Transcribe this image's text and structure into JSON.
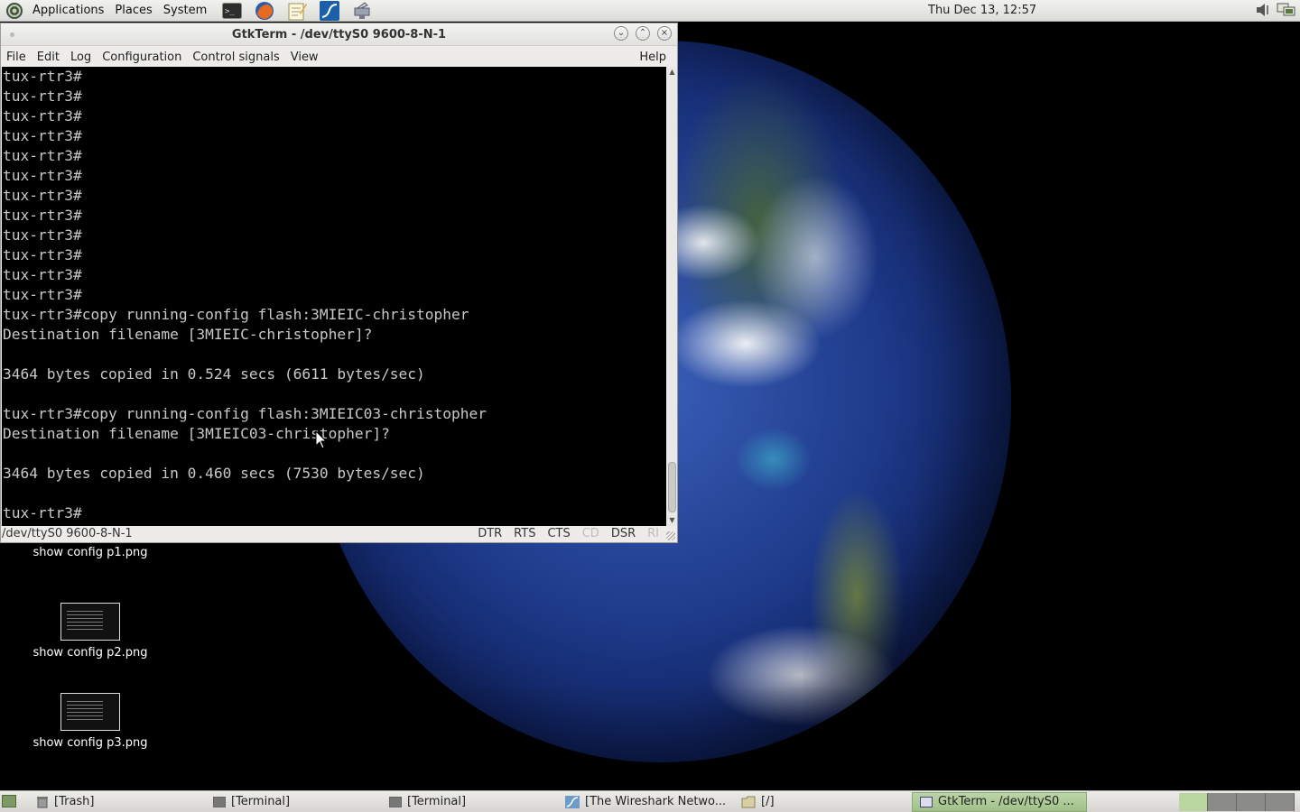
{
  "top_panel": {
    "menus": [
      "Applications",
      "Places",
      "System"
    ],
    "launchers": [
      "terminal-icon",
      "firefox-icon",
      "text-editor-icon",
      "wireshark-icon",
      "network-tool-icon"
    ],
    "clock": "Thu Dec 13, 12:57"
  },
  "window": {
    "title": "GtkTerm - /dev/ttyS0  9600-8-N-1",
    "menu": [
      "File",
      "Edit",
      "Log",
      "Configuration",
      "Control signals",
      "View"
    ],
    "help": "Help",
    "terminal_lines": [
      "tux-rtr3#",
      "tux-rtr3#",
      "tux-rtr3#",
      "tux-rtr3#",
      "tux-rtr3#",
      "tux-rtr3#",
      "tux-rtr3#",
      "tux-rtr3#",
      "tux-rtr3#",
      "tux-rtr3#",
      "tux-rtr3#",
      "tux-rtr3#",
      "tux-rtr3#copy running-config flash:3MIEIC-christopher",
      "Destination filename [3MIEIC-christopher]?",
      "",
      "3464 bytes copied in 0.524 secs (6611 bytes/sec)",
      "",
      "tux-rtr3#copy running-config flash:3MIEIC03-christopher",
      "Destination filename [3MIEIC03-christopher]?",
      "",
      "3464 bytes copied in 0.460 secs (7530 bytes/sec)",
      "",
      "tux-rtr3#"
    ],
    "status": {
      "port": "/dev/ttyS0  9600-8-N-1",
      "signals": [
        {
          "label": "DTR",
          "active": true
        },
        {
          "label": "RTS",
          "active": true
        },
        {
          "label": "CTS",
          "active": true
        },
        {
          "label": "CD",
          "active": false
        },
        {
          "label": "DSR",
          "active": true
        },
        {
          "label": "RI",
          "active": false
        }
      ]
    }
  },
  "desktop_icons": [
    {
      "label": "show config p1.png"
    },
    {
      "label": "show config p2.png"
    },
    {
      "label": "show config p3.png"
    }
  ],
  "taskbar": {
    "tasks": [
      {
        "label": "[Trash]",
        "icon": "trash-icon"
      },
      {
        "label": "[Terminal]",
        "icon": "terminal-icon"
      },
      {
        "label": "[Terminal]",
        "icon": "terminal-icon"
      },
      {
        "label": "[The Wireshark Netwo...",
        "icon": "wireshark-icon"
      },
      {
        "label": "[/]",
        "icon": "folder-icon"
      },
      {
        "label": "GtkTerm - /dev/ttyS0  ...",
        "icon": "window-icon",
        "active": true
      }
    ],
    "workspaces": 4,
    "active_workspace": 1
  },
  "colors": {
    "terminal_bg": "#000000",
    "terminal_fg": "#c8c8c8",
    "active_task": "#a8c690"
  }
}
